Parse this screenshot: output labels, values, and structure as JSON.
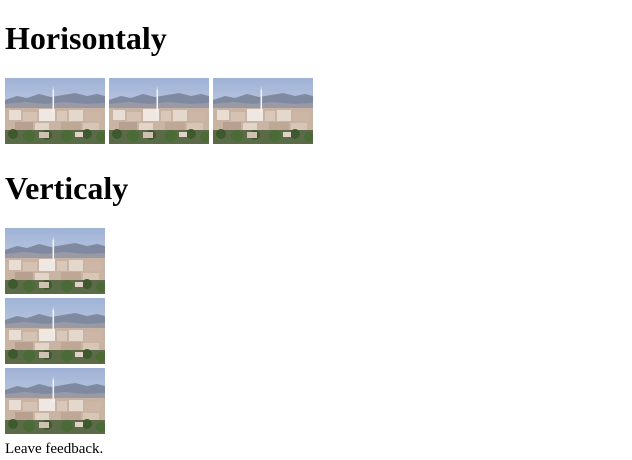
{
  "sections": {
    "horizontal": {
      "title": "Horisontaly",
      "images": [
        "city-photo",
        "city-photo",
        "city-photo"
      ]
    },
    "vertical": {
      "title": "Verticaly",
      "images": [
        "city-photo",
        "city-photo",
        "city-photo"
      ]
    }
  },
  "footer": {
    "text": "Leave feedback."
  },
  "colors": {
    "sky": "#b7c4dc",
    "mountains": "#7f8aa0",
    "buildings": "#d8c4b4",
    "foliage": "#3c5a2e"
  }
}
